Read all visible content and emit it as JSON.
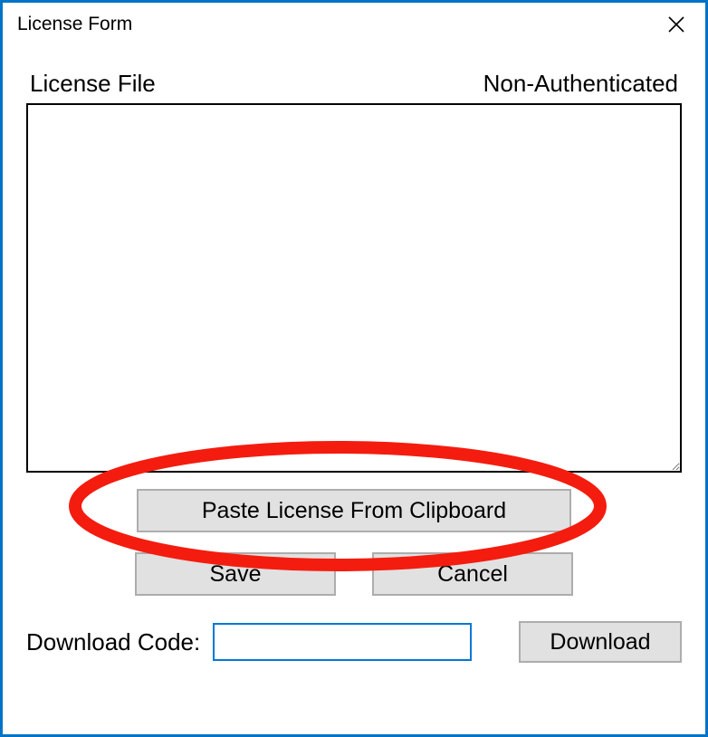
{
  "window": {
    "title": "License Form"
  },
  "labels": {
    "license_file": "License File",
    "auth_status": "Non-Authenticated",
    "download_code": "Download Code:"
  },
  "buttons": {
    "paste": "Paste License From Clipboard",
    "save": "Save",
    "cancel": "Cancel",
    "download": "Download"
  },
  "inputs": {
    "license_content": "",
    "download_code_value": ""
  },
  "annotation": {
    "highlight_color": "#F41C0F"
  }
}
